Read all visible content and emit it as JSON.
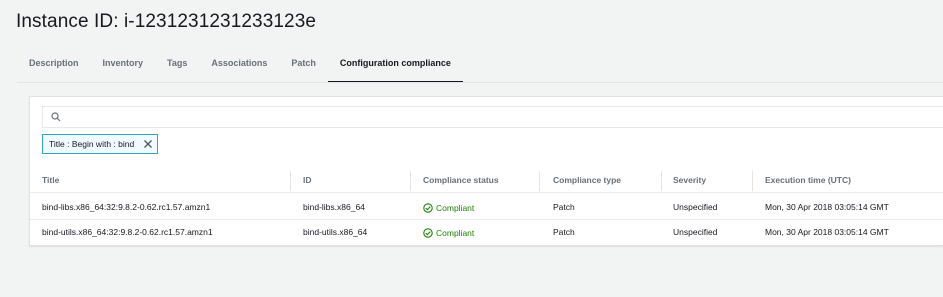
{
  "page": {
    "title": "Instance ID: i-1231231231233123e"
  },
  "tabs": [
    {
      "label": "Description"
    },
    {
      "label": "Inventory"
    },
    {
      "label": "Tags"
    },
    {
      "label": "Associations"
    },
    {
      "label": "Patch"
    },
    {
      "label": "Configuration compliance",
      "active": true
    }
  ],
  "filter": {
    "search_value": "",
    "search_icon": "search-icon",
    "token_label": "Title : Begin with : bind",
    "token_close_icon": "close-icon"
  },
  "table": {
    "columns": [
      "Title",
      "ID",
      "Compliance status",
      "Compliance type",
      "Severity",
      "Execution time (UTC)"
    ],
    "rows": [
      {
        "title": "bind-libs.x86_64:32:9.8.2-0.62.rc1.57.amzn1",
        "id": "bind-libs.x86_64",
        "status": "Compliant",
        "type": "Patch",
        "severity": "Unspecified",
        "time": "Mon, 30 Apr 2018 03:05:14 GMT"
      },
      {
        "title": "bind-utils.x86_64:32:9.8.2-0.62.rc1.57.amzn1",
        "id": "bind-utils.x86_64",
        "status": "Compliant",
        "type": "Patch",
        "severity": "Unspecified",
        "time": "Mon, 30 Apr 2018 03:05:14 GMT"
      }
    ]
  },
  "colors": {
    "accent": "#16191f",
    "compliant": "#1d8102",
    "token_border": "#2fa8c3"
  }
}
